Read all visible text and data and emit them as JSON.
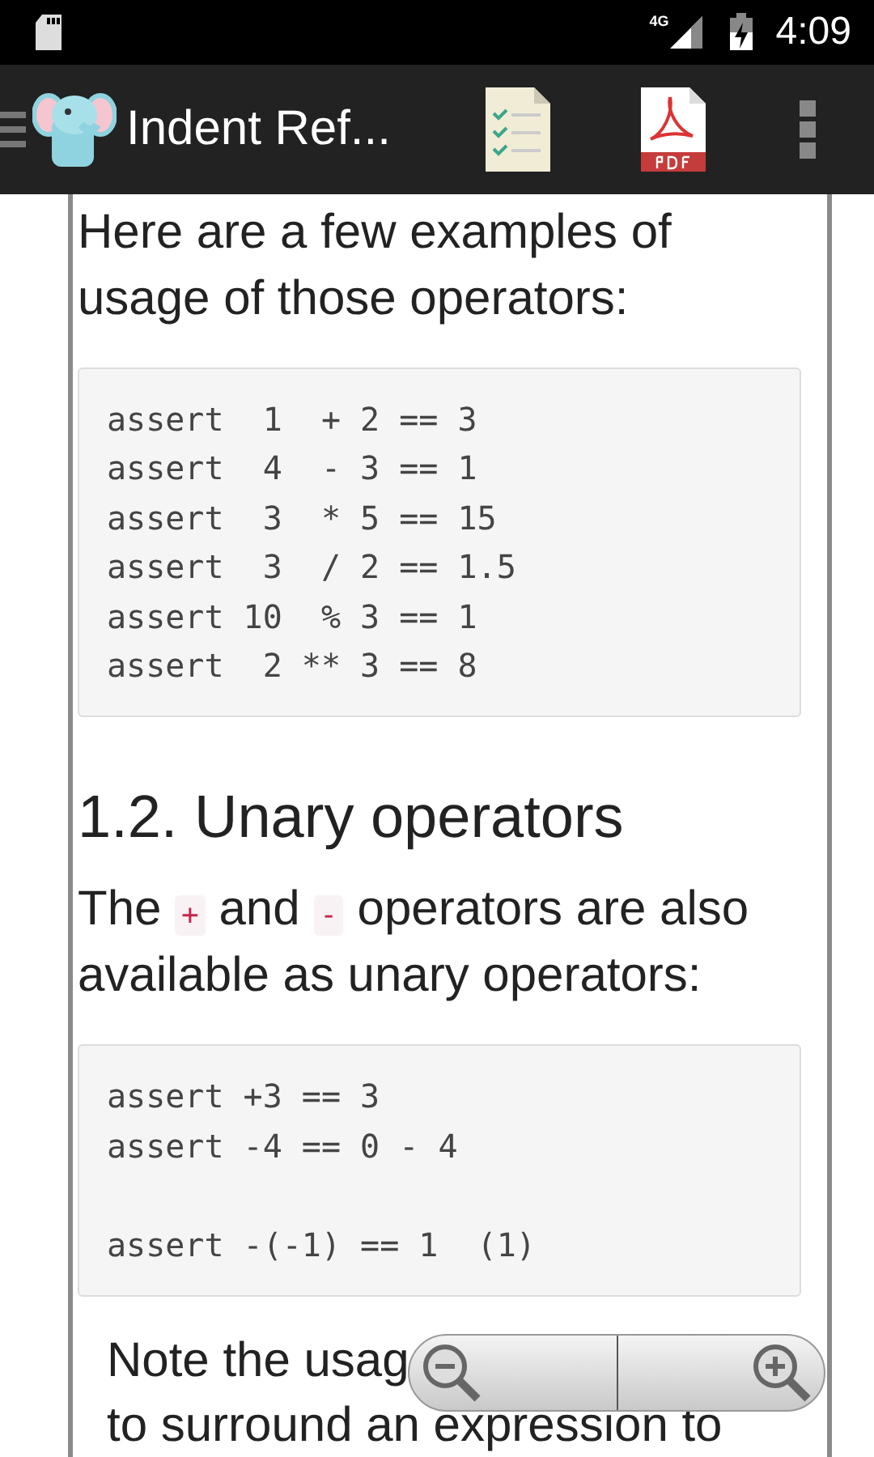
{
  "status_bar": {
    "network": "4G",
    "time": "4:09"
  },
  "app_bar": {
    "title": "Indent Ref..."
  },
  "document": {
    "intro": "Here are a few examples of usage of those operators:",
    "code_block_1": [
      "assert  1  + 2 == 3",
      "assert  4  - 3 == 1",
      "assert  3  * 5 == 15",
      "assert  3  / 2 == 1.5",
      "assert 10  % 3 == 1",
      "assert  2 ** 3 == 8"
    ],
    "heading": "1.2. Unary operators",
    "paragraph": [
      {
        "kind": "text",
        "text": "The "
      },
      {
        "kind": "code",
        "text": "+"
      },
      {
        "kind": "text",
        "text": " and "
      },
      {
        "kind": "code",
        "text": "-"
      },
      {
        "kind": "text",
        "text": " operators are also available as unary operators:"
      }
    ],
    "code_block_2": [
      [
        "assert +3 == 3",
        "assert -4 == 0 - 4"
      ],
      [
        "assert -(-1) == 1  (1)"
      ]
    ],
    "note_lines": [
      "Note the usag",
      "to surround an expression to"
    ]
  }
}
